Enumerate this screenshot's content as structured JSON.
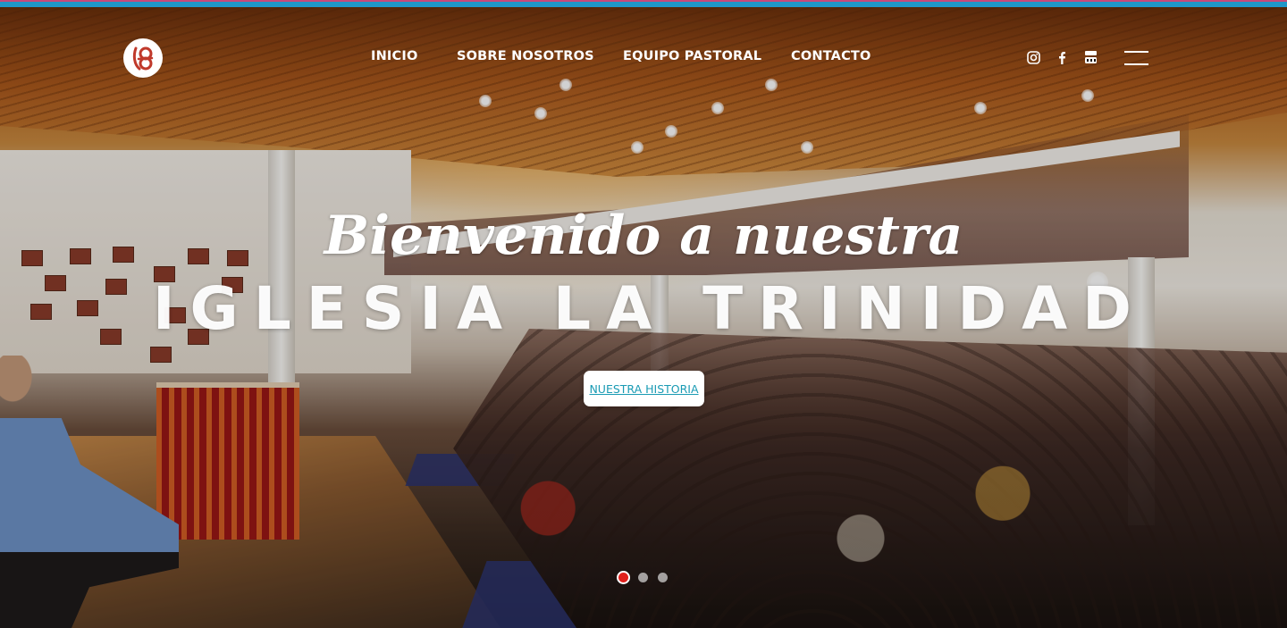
{
  "brand": {
    "logo_icon": "church-logo-icon"
  },
  "nav": {
    "items": [
      {
        "label": "INICIO"
      },
      {
        "label": "SOBRE NOSOTROS"
      },
      {
        "label": "EQUIPO PASTORAL"
      },
      {
        "label": "CONTACTO"
      }
    ]
  },
  "social": {
    "icons": [
      "instagram-icon",
      "facebook-icon",
      "youtube-icon"
    ]
  },
  "menu": {
    "icon": "hamburger-menu-icon"
  },
  "hero": {
    "headline": "Bienvenido a nuestra",
    "subheadline": "IGLESIA LA TRINIDAD",
    "cta_label": "NUESTRA HISTORIA",
    "slides": {
      "count": 3,
      "active_index": 0
    }
  },
  "colors": {
    "accent_bar": "#1f97c8",
    "accent_bar_top": "#c84a7a",
    "cta_text": "#1a9bb4",
    "active_dot": "#e0201c"
  }
}
